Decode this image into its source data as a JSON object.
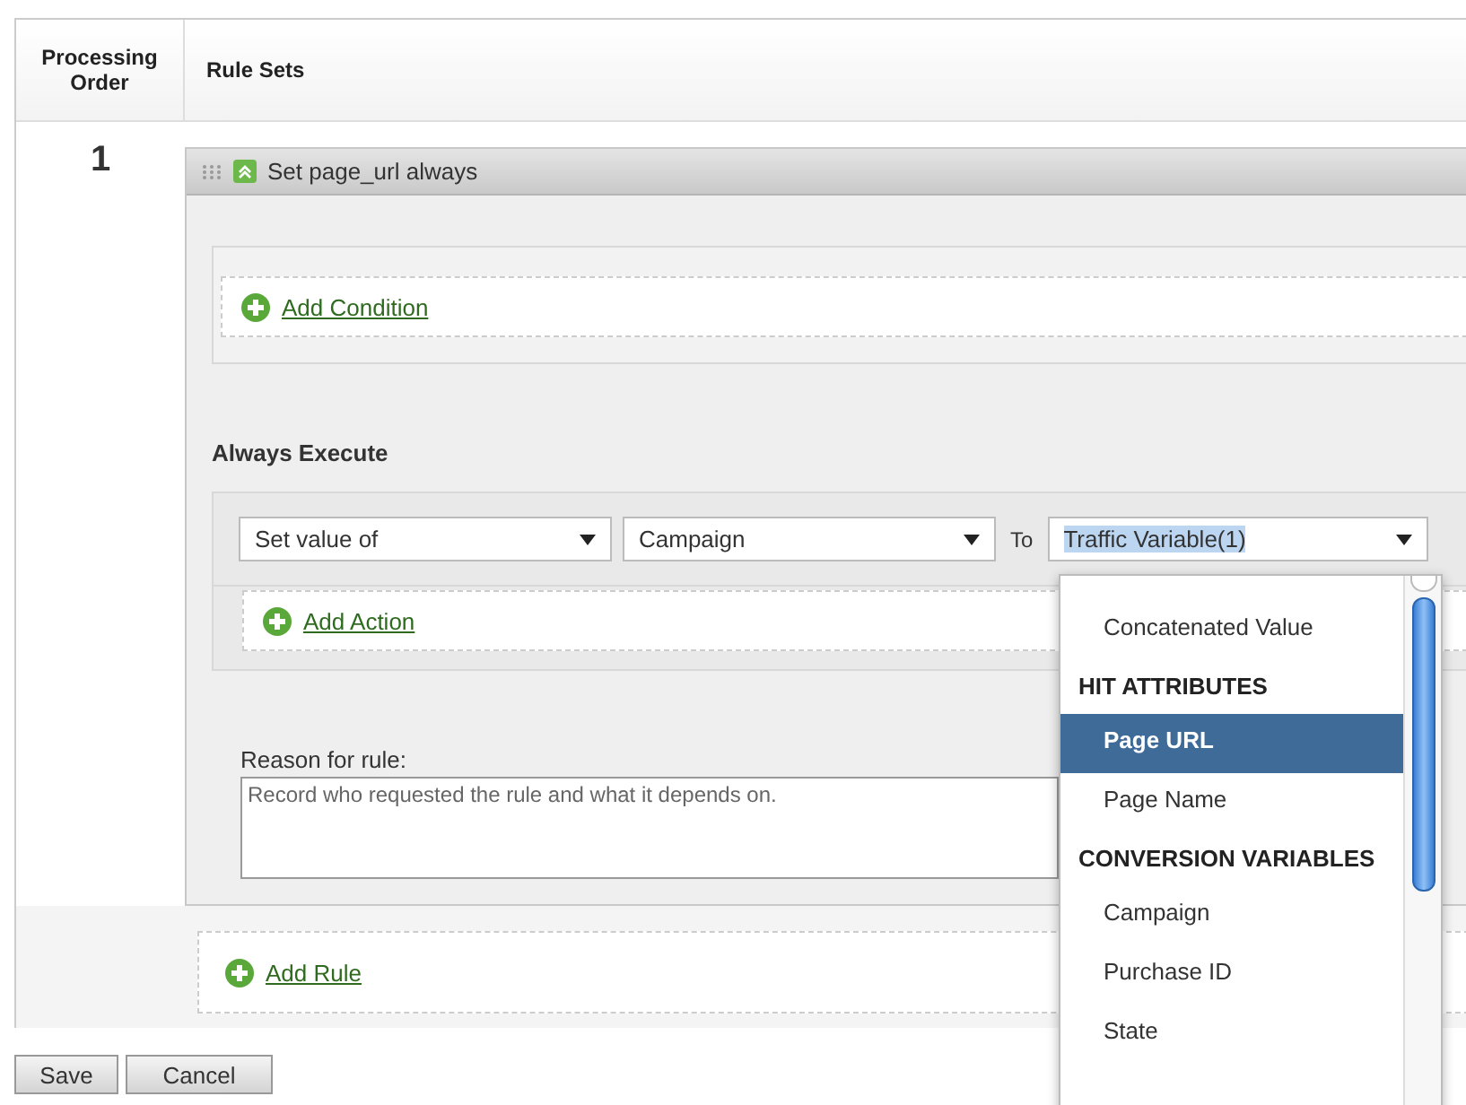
{
  "table": {
    "columns": [
      "Processing Order",
      "Rule Sets"
    ],
    "rows": [
      {
        "order": "1",
        "rule": {
          "title": "Set page_url always",
          "add_condition": "Add Condition",
          "section_title": "Always Execute",
          "action": {
            "operation": "Set value of",
            "variable": "Campaign",
            "to_label": "To",
            "target": "Traffic Variable(1)"
          },
          "add_action": "Add Action",
          "reason_label": "Reason for rule:",
          "reason": "Record who requested the rule and what it depends on."
        }
      }
    ],
    "add_rule": "Add Rule"
  },
  "dropdown": {
    "items": [
      {
        "kind": "option",
        "label": "Concatenated Value",
        "selected": false
      },
      {
        "kind": "group",
        "label": "HIT ATTRIBUTES"
      },
      {
        "kind": "option",
        "label": "Page URL",
        "selected": true
      },
      {
        "kind": "option",
        "label": "Page Name",
        "selected": false
      },
      {
        "kind": "group",
        "label": "CONVERSION VARIABLES"
      },
      {
        "kind": "option",
        "label": "Campaign",
        "selected": false
      },
      {
        "kind": "option",
        "label": "Purchase ID",
        "selected": false
      },
      {
        "kind": "option",
        "label": "State",
        "selected": false
      }
    ]
  },
  "buttons": [
    "Save",
    "Cancel"
  ]
}
